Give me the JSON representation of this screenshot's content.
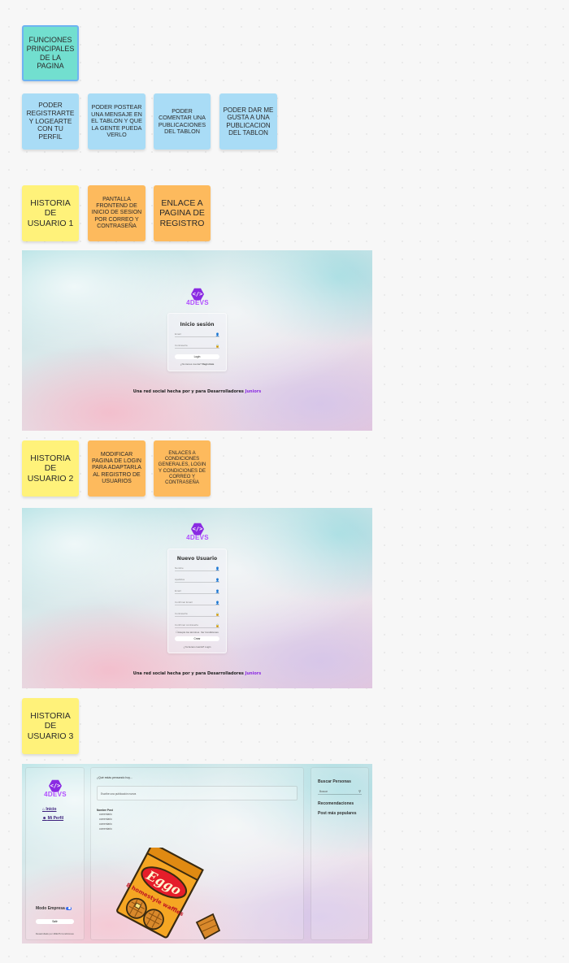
{
  "features": {
    "title": "FUNCIONES PRINCIPALES DE LA PAGINA",
    "items": [
      "PODER REGISTRARTE Y LOGEARTE CON TU PERFIL",
      "PODER POSTEAR UNA MENSAJE EN EL TABLON Y QUE LA GENTE PUEDA VERLO",
      "PODER COMENTAR UNA PUBLICACIONES DEL TABLON",
      "PODER DAR ME GUSTA A UNA PUBLICACION DEL TABLON"
    ]
  },
  "story1": {
    "label": "HISTORIA DE USUARIO 1",
    "task1": "PANTALLA FRONTEND DE INICIO DE SESION POR CORREO Y CONTRASEÑA",
    "task2": "ENLACE A PAGINA DE REGISTRO"
  },
  "story2": {
    "label": "HISTORIA DE USUARIO 2",
    "task1": "MODIFICAR PAGINA DE LOGIN PARA ADAPTARLA AL REGISTRO DE USUARIOS",
    "task2": "ENLACES A CONDICIONES GENERALES, LOGIN Y CONDICIONES DE CORREO Y CONTRASEÑA"
  },
  "story3": {
    "label": "HISTORIA DE USUARIO 3"
  },
  "brand": {
    "logo_glyph": "</>",
    "logo_text": "4DEVS",
    "tagline_main": "Una red social hecha por y para Desarrolladores ",
    "tagline_highlight": "Juniors"
  },
  "login": {
    "title": "Inicio sesión",
    "field_email": "Email",
    "field_password": "Contraseña",
    "login_button": "Login",
    "register_prompt": "¿No tienes cuenta? ",
    "register_link": "Registrate"
  },
  "register": {
    "title": "Nuevo Usuario",
    "fields": [
      "Nombre",
      "Apellidos",
      "Email",
      "Confirmar Email",
      "Contraseña",
      "Confirmar contraseña"
    ],
    "checkbox1": "Acepto los términos",
    "checkbox2": "Ver Condiciones",
    "create_button": "Crear",
    "login_prompt": "¿Ya tienes cuenta? Login"
  },
  "app": {
    "nav_home": "Inicio",
    "nav_profile": "Mi Perfil",
    "prompt": "¿Qué estás pensando hoy...",
    "input_placeholder": "Escribe una publicación nueva",
    "feed_author": "Nombre Post",
    "feed_lines": [
      "comentario",
      "comentario",
      "comentario",
      "comentario"
    ],
    "company_mode": "Modo Empresa",
    "exit_button": "Salir",
    "footer": "Desarrollado por 4DEVS Condiciones",
    "search_title": "Buscar Personas",
    "search_placeholder": "Buscar",
    "recommendations": "Recomendaciones",
    "popular_posts": "Post más populares",
    "box_brand": "Eggo",
    "box_subtitle": "8 homestyle waffles"
  },
  "colors": {
    "teal": "#72dfcf",
    "blue": "#a9dcf6",
    "yellow": "#fff27a",
    "orange": "#fdba5d",
    "brand_purple": "#8a2be2"
  }
}
